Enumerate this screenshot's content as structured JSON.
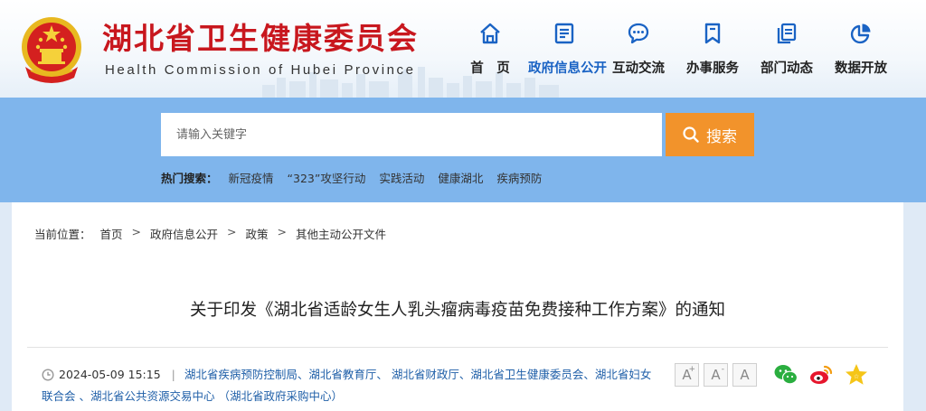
{
  "header": {
    "title": "湖北省卫生健康委员会",
    "subtitle": "Health Commission of Hubei Province"
  },
  "nav": [
    {
      "label": "首　页",
      "icon": "home-icon"
    },
    {
      "label": "政府信息公开",
      "icon": "document-icon",
      "active": true
    },
    {
      "label": "互动交流",
      "icon": "chat-bubble-icon"
    },
    {
      "label": "办事服务",
      "icon": "bookmark-icon"
    },
    {
      "label": "部门动态",
      "icon": "copy-icon"
    },
    {
      "label": "数据开放",
      "icon": "pie-chart-icon"
    }
  ],
  "search": {
    "placeholder": "请输入关键字",
    "button": "搜索"
  },
  "hot": {
    "label": "热门搜索：",
    "items": [
      "新冠疫情",
      "“323”攻坚行动",
      "实践活动",
      "健康湖北",
      "疾病预防"
    ]
  },
  "breadcrumb": {
    "label": "当前位置：",
    "items": [
      "首页",
      "政府信息公开",
      "政策",
      "其他主动公开文件"
    ]
  },
  "article": {
    "title": "关于印发《湖北省适龄女生人乳头瘤病毒疫苗免费接种工作方案》的通知",
    "date": "2024-05-09 15:15",
    "sources": "湖北省疾病预防控制局、湖北省教育厅、 湖北省财政厅、湖北省卫生健康委员会、湖北省妇女联合会 、湖北省公共资源交易中心 （湖北省政府采购中心）"
  },
  "font_controls": [
    "A",
    "A",
    "A"
  ],
  "share": [
    "wechat-icon",
    "weibo-icon",
    "favorite-star-icon"
  ],
  "colors": {
    "brand_red": "#c8171e",
    "nav_blue": "#1a63c4",
    "band_blue": "#7fb5ec",
    "search_orange": "#f2932b"
  }
}
